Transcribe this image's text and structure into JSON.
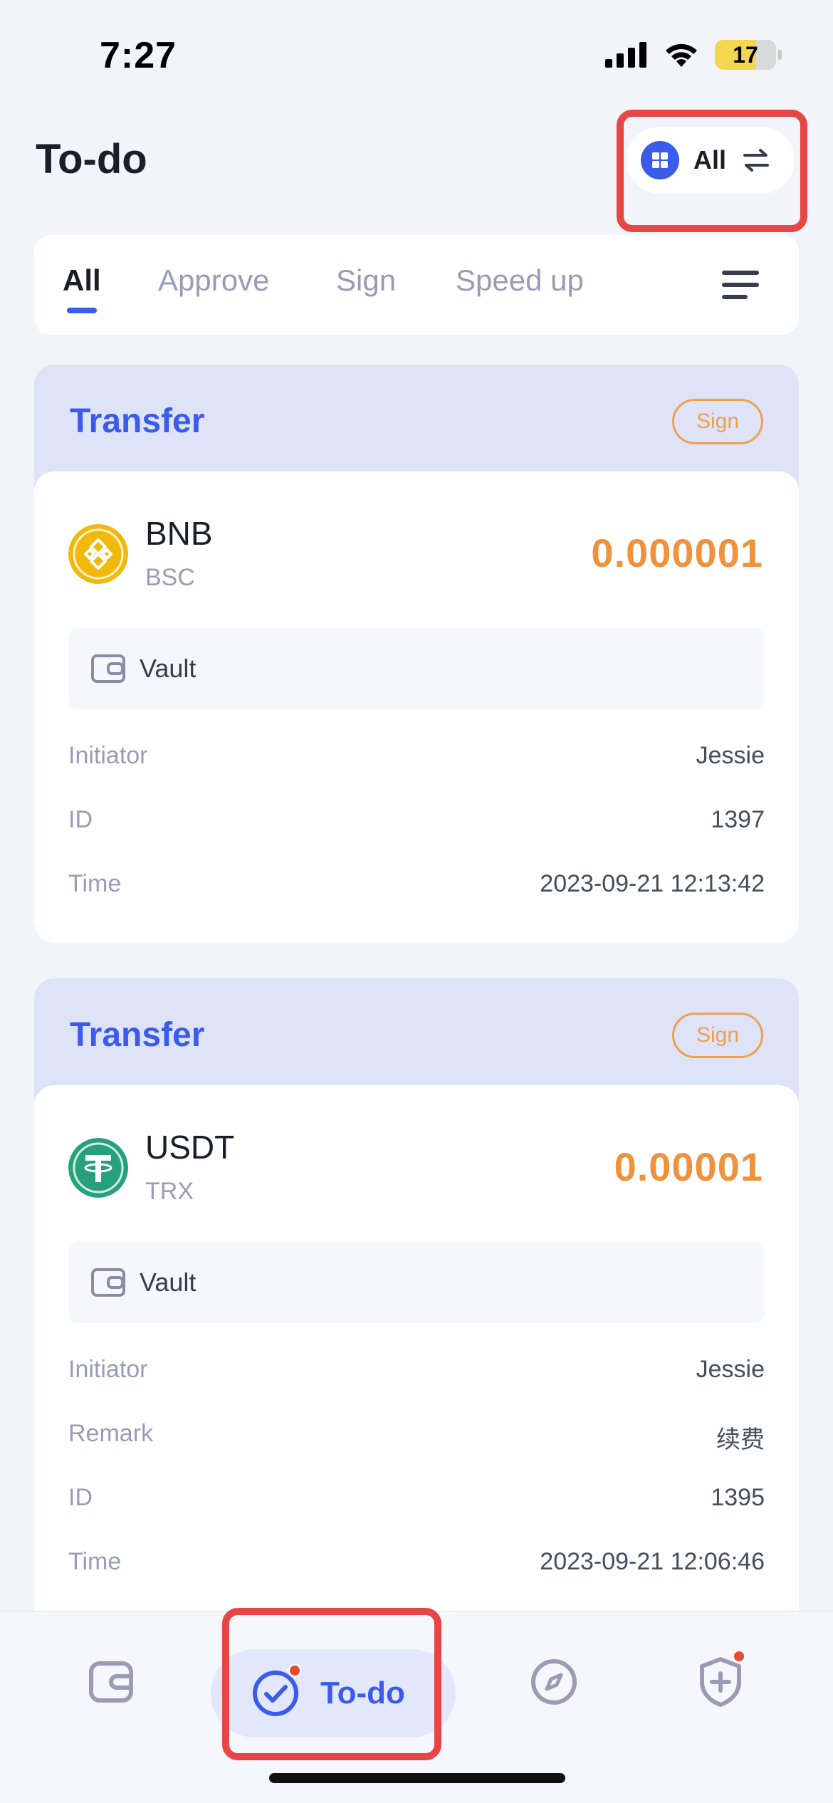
{
  "status_bar": {
    "time": "7:27",
    "battery": "17"
  },
  "header": {
    "title": "To-do",
    "scope_label": "All"
  },
  "tabs": [
    {
      "label": "All",
      "active": true
    },
    {
      "label": "Approve",
      "active": false
    },
    {
      "label": "Sign",
      "active": false
    },
    {
      "label": "Speed up",
      "active": false
    }
  ],
  "transactions": [
    {
      "type": "Transfer",
      "badge": "Sign",
      "coin": "BNB",
      "chain": "BSC",
      "amount": "0.000001",
      "vault": "Vault",
      "details": [
        {
          "label": "Initiator",
          "value": "Jessie"
        },
        {
          "label": "ID",
          "value": "1397"
        },
        {
          "label": "Time",
          "value": "2023-09-21 12:13:42"
        }
      ]
    },
    {
      "type": "Transfer",
      "badge": "Sign",
      "coin": "USDT",
      "chain": "TRX",
      "amount": "0.00001",
      "vault": "Vault",
      "details": [
        {
          "label": "Initiator",
          "value": "Jessie"
        },
        {
          "label": "Remark",
          "value": "续费"
        },
        {
          "label": "ID",
          "value": "1395"
        },
        {
          "label": "Time",
          "value": "2023-09-21 12:06:46"
        }
      ]
    }
  ],
  "bottom_nav": {
    "active_label": "To-do"
  },
  "colors": {
    "accent": "#3B5BEB",
    "amount": "#F0923B",
    "highlight": "#E84545",
    "bnb": "#F0B90B",
    "usdt": "#26A17B"
  }
}
